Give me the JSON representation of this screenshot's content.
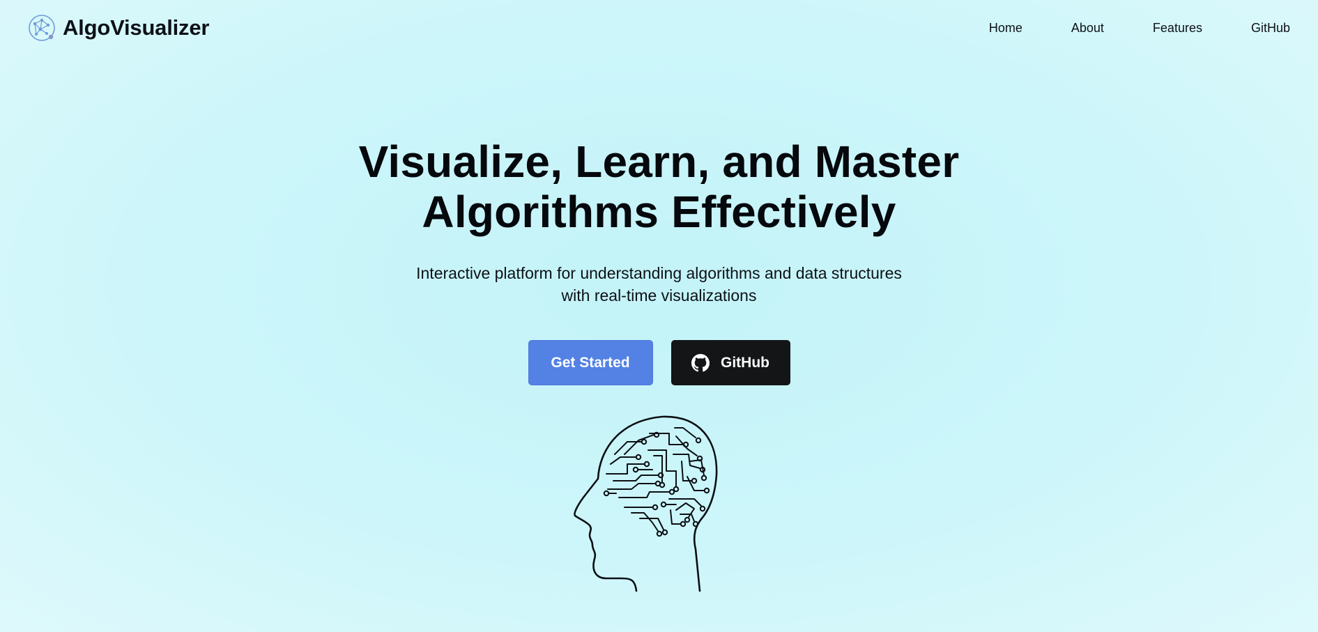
{
  "brand": {
    "name": "AlgoVisualizer",
    "logo_icon": "network-logo-icon"
  },
  "nav": {
    "items": [
      {
        "label": "Home"
      },
      {
        "label": "About"
      },
      {
        "label": "Features"
      },
      {
        "label": "GitHub"
      }
    ]
  },
  "hero": {
    "title_line1": "Visualize, Learn, and Master",
    "title_line2": "Algorithms Effectively",
    "subtitle_line1": "Interactive platform for understanding algorithms and data structures",
    "subtitle_line2": "with real-time visualizations",
    "primary_button": "Get Started",
    "secondary_button": "GitHub",
    "secondary_icon": "github-icon",
    "illustration": "circuit-brain-head-icon"
  },
  "colors": {
    "primary": "#5381e4",
    "dark": "#141517",
    "background": "#cdf6fa"
  }
}
